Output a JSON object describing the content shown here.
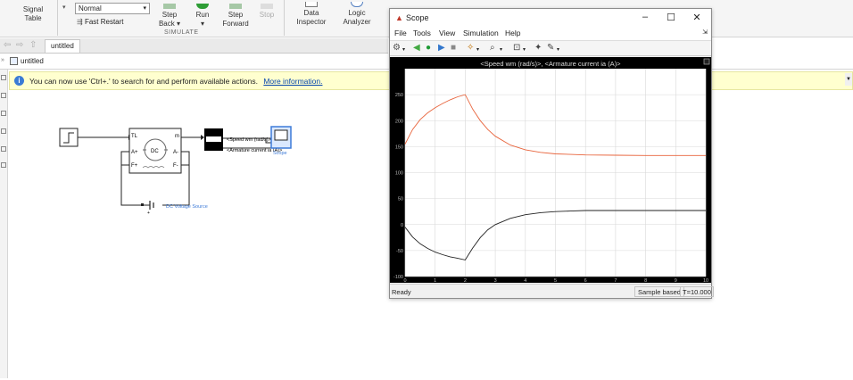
{
  "toolstrip": {
    "signal_table": "Signal\nTable",
    "sim_mode": "Normal",
    "fast_restart": "Fast Restart",
    "step_back": "Step\nBack",
    "run": "Run",
    "step_forward": "Step\nForward",
    "stop": "Stop",
    "section_label": "SIMULATE",
    "data_inspector": "Data\nInspector",
    "logic_analyzer": "Logic\nAnalyzer"
  },
  "tabs": {
    "model_tab": "untitled"
  },
  "address": {
    "path": "untitled"
  },
  "infobar": {
    "message": "You can now use 'Ctrl+.' to search for and perform available actions.",
    "link": "More information."
  },
  "model": {
    "dc_label": "DC",
    "port_tl": "TL",
    "port_m": "m",
    "port_aplus": "A+",
    "port_aminus": "A-",
    "port_fplus": "F+",
    "port_fminus": "F-",
    "signal_speed": "<Speed wm (rad/s)>",
    "signal_current": "<Armature current ia (A)>",
    "scope_label": "Scope",
    "voltage_label": "DC Voltage Source"
  },
  "scope_window": {
    "title": "Scope",
    "menu": [
      "File",
      "Tools",
      "View",
      "Simulation",
      "Help"
    ],
    "status_ready": "Ready",
    "status_sample": "Sample based",
    "status_time": "T=10.000"
  },
  "chart_data": {
    "type": "line",
    "title": "<Speed wm (rad/s)>, <Armature current ia (A)>",
    "xlim": [
      0,
      10
    ],
    "ylim": [
      -100,
      300
    ],
    "xticks": [
      0,
      1,
      2,
      3,
      4,
      5,
      6,
      7,
      8,
      9,
      10
    ],
    "yticks": [
      -100,
      -50,
      0,
      50,
      100,
      150,
      200,
      250
    ],
    "grid": true,
    "background": "#ffffff",
    "series": [
      {
        "color": "#e8643c",
        "x": [
          0,
          0.25,
          0.5,
          0.75,
          1,
          1.25,
          1.5,
          1.75,
          2,
          2.25,
          2.5,
          2.75,
          3,
          3.5,
          4,
          4.5,
          5,
          5.5,
          6,
          7,
          8,
          9,
          10
        ],
        "values": [
          155,
          183,
          202,
          215,
          225,
          233,
          240,
          246,
          250,
          222,
          200,
          183,
          170,
          153,
          144,
          139,
          136,
          135,
          134,
          133.5,
          133,
          133,
          133
        ]
      },
      {
        "color": "#222222",
        "x": [
          0,
          0.25,
          0.5,
          0.75,
          1,
          1.25,
          1.5,
          1.75,
          2,
          2.25,
          2.5,
          2.75,
          3,
          3.5,
          4,
          4.5,
          5,
          5.5,
          6,
          7,
          8,
          9,
          10
        ],
        "values": [
          -5,
          -24,
          -37,
          -46,
          -53,
          -58,
          -62,
          -65,
          -68,
          -45,
          -25,
          -10,
          0,
          12,
          19,
          23,
          25,
          26,
          27,
          27,
          27,
          27,
          27
        ]
      }
    ]
  }
}
